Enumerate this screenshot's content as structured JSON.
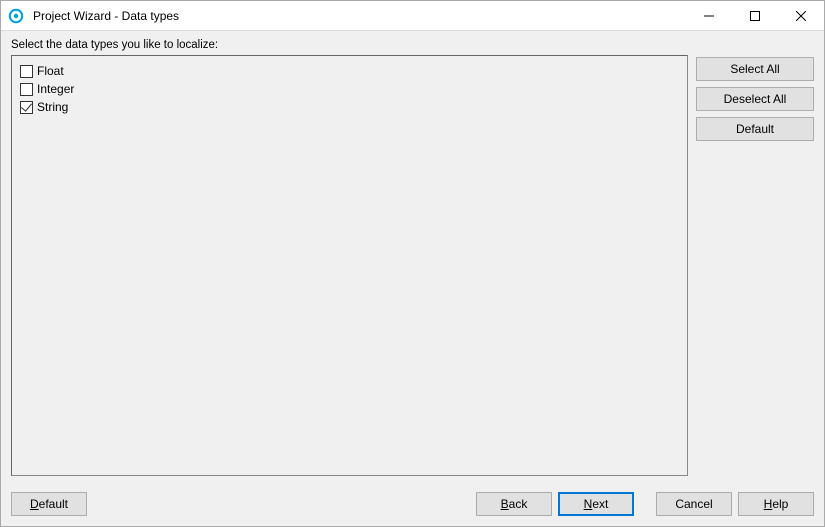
{
  "window": {
    "title": "Project Wizard - Data types"
  },
  "instruction": "Select the data types you like to localize:",
  "dataTypes": [
    {
      "label": "Float",
      "checked": false
    },
    {
      "label": "Integer",
      "checked": false
    },
    {
      "label": "String",
      "checked": true
    }
  ],
  "sideButtons": {
    "selectAll": "Select All",
    "deselectAll": "Deselect All",
    "default": "Default"
  },
  "bottom": {
    "default": "Default",
    "back": "Back",
    "next": "Next",
    "cancel": "Cancel",
    "help": "Help"
  }
}
